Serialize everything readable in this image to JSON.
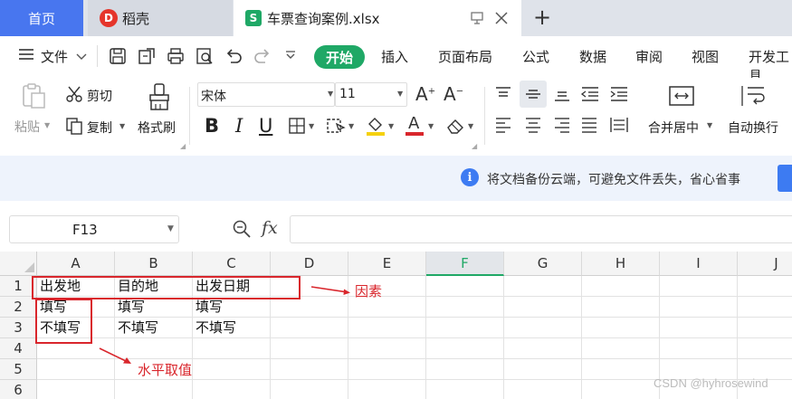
{
  "tabs": {
    "home": "首页",
    "daoke": "稻壳",
    "daoke_logo": "D",
    "file": "车票查询案例.xlsx",
    "file_logo": "S",
    "new_tab": "+"
  },
  "menu": {
    "hamburger": "≡",
    "file": "文件",
    "items": [
      "开始",
      "插入",
      "页面布局",
      "公式",
      "数据",
      "审阅",
      "视图",
      "开发工具"
    ]
  },
  "ribbon": {
    "paste": "粘贴",
    "cut": "剪切",
    "copy": "复制",
    "format_painter": "格式刷",
    "font_name": "宋体",
    "font_size": "11",
    "bold": "B",
    "italic": "I",
    "underline": "U",
    "merge_center": "合并居中",
    "wrap_text": "自动换行"
  },
  "notice": {
    "icon": "i",
    "text": "将文档备份云端，可避免文件丢失，省心省事"
  },
  "formula_bar": {
    "name_box": "F13",
    "fx": "fx"
  },
  "grid": {
    "columns": [
      "A",
      "B",
      "C",
      "D",
      "E",
      "F",
      "G",
      "H",
      "I",
      "J"
    ],
    "rows": [
      "1",
      "2",
      "3",
      "4",
      "5",
      "6"
    ],
    "selected_column": "F",
    "cells": {
      "A1": "出发地",
      "B1": "目的地",
      "C1": "出发日期",
      "A2": "填写",
      "B2": "填写",
      "C2": "填写",
      "A3": "不填写",
      "B3": "不填写",
      "C3": "不填写"
    }
  },
  "annotations": {
    "factor": "因素",
    "level": "水平取值",
    "color": "#d9262c"
  },
  "watermark": "CSDN @hyhrosewind",
  "colors": {
    "accent_green": "#1fa866",
    "tab_blue": "#4876ef",
    "info_blue": "#3d7bf2"
  }
}
